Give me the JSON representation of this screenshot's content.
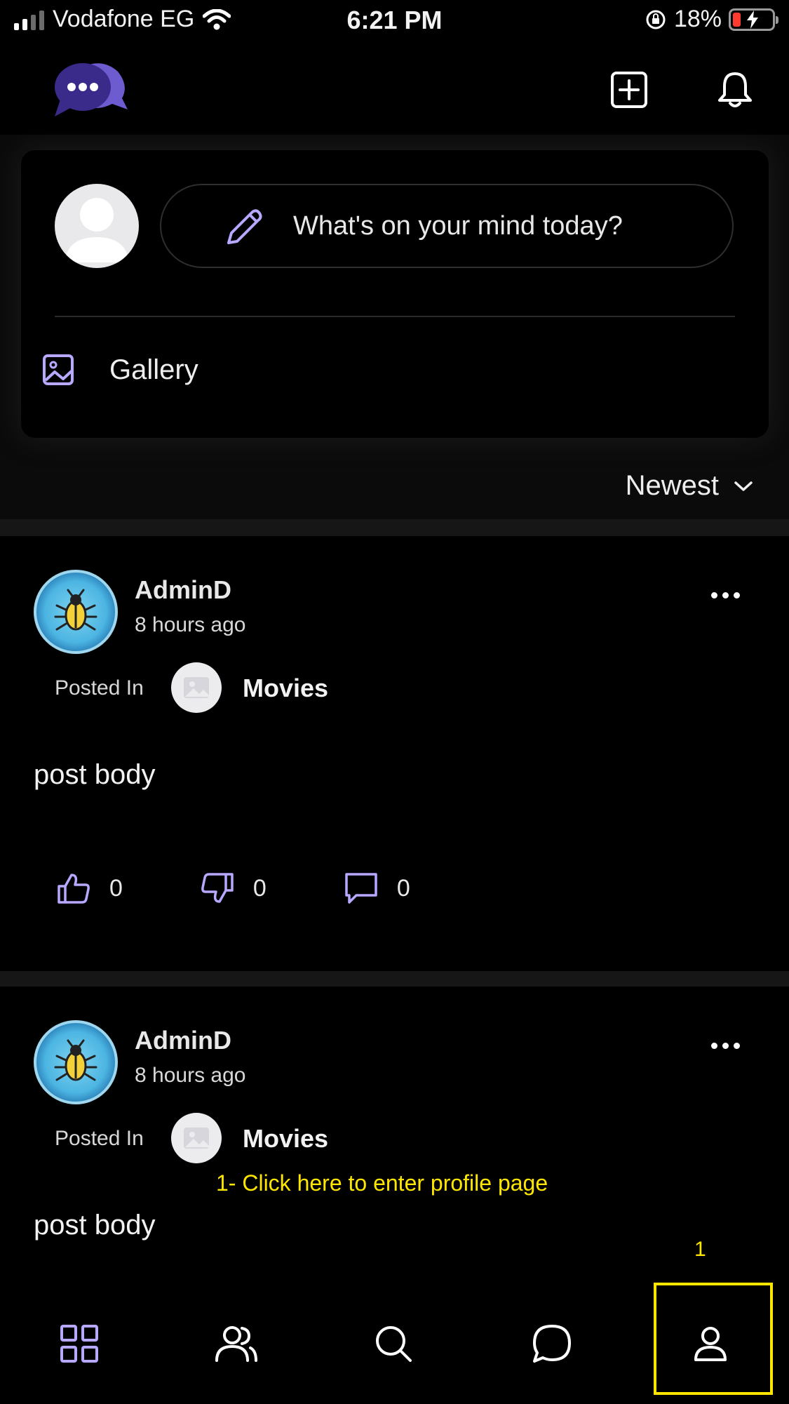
{
  "status_bar": {
    "carrier": "Vodafone EG",
    "time": "6:21 PM",
    "battery_percent": "18%"
  },
  "header": {
    "logo_icon": "chat-bubbles-logo",
    "actions": [
      {
        "icon": "add-square-icon"
      },
      {
        "icon": "bell-icon"
      }
    ]
  },
  "composer": {
    "placeholder": "What's on your mind today?",
    "gallery_label": "Gallery"
  },
  "sort": {
    "selected": "Newest"
  },
  "posts": [
    {
      "author": "AdminD",
      "time": "8 hours ago",
      "posted_in_label": "Posted In",
      "category": "Movies",
      "body": "post body",
      "likes": "0",
      "dislikes": "0",
      "comments": "0"
    },
    {
      "author": "AdminD",
      "time": "8 hours ago",
      "posted_in_label": "Posted In",
      "category": "Movies",
      "body": "post body"
    }
  ],
  "annotation": {
    "text": "1- Click here to enter profile page",
    "number": "1"
  },
  "bottom_nav": [
    {
      "icon": "grid-icon",
      "active": true
    },
    {
      "icon": "users-icon"
    },
    {
      "icon": "search-icon"
    },
    {
      "icon": "chat-icon"
    },
    {
      "icon": "profile-icon"
    }
  ],
  "colors": {
    "accent": "#b9a8ff",
    "annotation": "#ffe600",
    "background": "#000000"
  }
}
